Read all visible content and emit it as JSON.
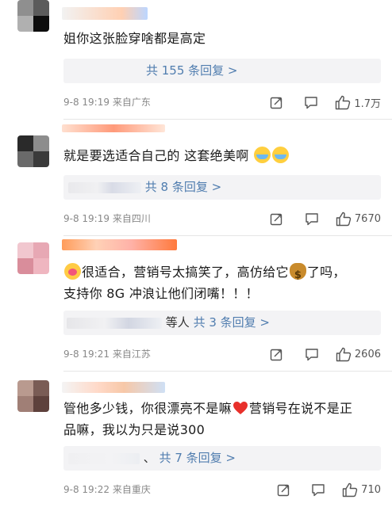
{
  "icons": {
    "share": "share-icon",
    "comment": "comment-icon",
    "like": "thumbs-up-icon"
  },
  "colors": {
    "link": "#507daf",
    "meta": "#888888",
    "reply_bg": "#f3f3f5",
    "like_heart": "#e8302b"
  },
  "comments": [
    {
      "text": "姐你这张脸穿啥都是高定",
      "reply_prefix": "",
      "reply_label": "共 155 条回复 >",
      "time": "9-8 19:19",
      "location": "来自广东",
      "likes": "1.7万"
    },
    {
      "text": "就是要选适合自己的 这套绝美啊",
      "emojis": [
        "crying-emoji",
        "crying-emoji"
      ],
      "reply_prefix": "",
      "reply_label": "共 8 条回复 >",
      "time": "9-8 19:19",
      "location": "来自四川",
      "likes": "7670"
    },
    {
      "text_a": "很适合，营销号太搞笑了，高仿给它",
      "text_b": "了吗，",
      "text_c": "支持你 8G 冲浪让他们闭嘴！！！",
      "emojis": [
        "blushing-emoji",
        "money-bag-emoji"
      ],
      "reply_prefix": "等人",
      "reply_label": "共 3 条回复 >",
      "time": "9-8 19:21",
      "location": "来自江苏",
      "likes": "2606"
    },
    {
      "text_a": "管他多少钱，你很漂亮不是嘛",
      "text_b": "营销号在说不是正",
      "text_c": "品嘛，我以为只是说300",
      "emojis": [
        "red-heart-emoji"
      ],
      "reply_prefix": "、",
      "reply_label": "共 7 条回复 >",
      "time": "9-8 19:22",
      "location": "来自重庆",
      "likes": "710"
    }
  ]
}
